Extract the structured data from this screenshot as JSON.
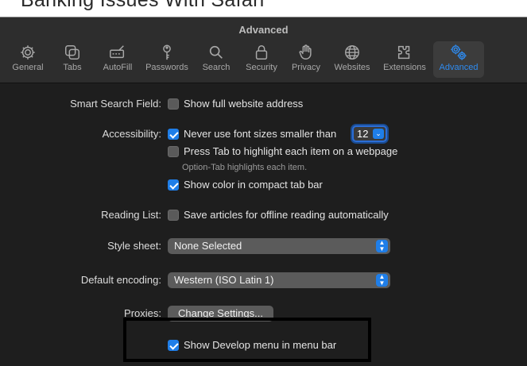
{
  "article_heading": "Banking Issues With Safari",
  "window": {
    "title": "Advanced"
  },
  "tabs": [
    {
      "label": "General",
      "icon": "gear-icon"
    },
    {
      "label": "Tabs",
      "icon": "tabs-icon"
    },
    {
      "label": "AutoFill",
      "icon": "autofill-icon"
    },
    {
      "label": "Passwords",
      "icon": "key-icon"
    },
    {
      "label": "Search",
      "icon": "search-icon"
    },
    {
      "label": "Security",
      "icon": "lock-icon"
    },
    {
      "label": "Privacy",
      "icon": "hand-icon"
    },
    {
      "label": "Websites",
      "icon": "globe-icon"
    },
    {
      "label": "Extensions",
      "icon": "puzzle-icon"
    },
    {
      "label": "Advanced",
      "icon": "gears-icon",
      "active": true
    }
  ],
  "settings": {
    "smart_search": {
      "label": "Smart Search Field:",
      "option": "Show full website address",
      "checked": false
    },
    "accessibility": {
      "label": "Accessibility:",
      "font_option": "Never use font sizes smaller than",
      "font_checked": true,
      "font_size": "12",
      "tab_option": "Press Tab to highlight each item on a webpage",
      "tab_checked": false,
      "tab_hint": "Option-Tab highlights each item.",
      "color_option": "Show color in compact tab bar",
      "color_checked": true
    },
    "reading_list": {
      "label": "Reading List:",
      "option": "Save articles for offline reading automatically",
      "checked": false
    },
    "style_sheet": {
      "label": "Style sheet:",
      "value": "None Selected"
    },
    "encoding": {
      "label": "Default encoding:",
      "value": "Western (ISO Latin 1)"
    },
    "proxies": {
      "label": "Proxies:",
      "button": "Change Settings..."
    },
    "develop": {
      "option": "Show Develop menu in menu bar",
      "checked": true
    }
  },
  "colors": {
    "accent": "#1f7ee8",
    "background": "#1e1e1e",
    "toolbar": "#2d2d2d",
    "highlight_box": "#000000"
  }
}
